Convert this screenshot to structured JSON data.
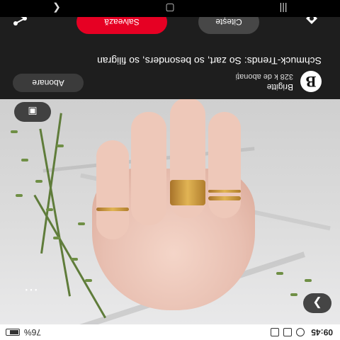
{
  "status_bar": {
    "time": "09:45",
    "battery": "76%"
  },
  "pin": {
    "author": "Brigitte",
    "followers": "328 k de abonați",
    "follow_label": "Abonare",
    "title": "Schmuck-Trends: So zart, so besonders, so filigran",
    "avatar_letter": "B"
  },
  "actions": {
    "read_label": "Citește",
    "save_label": "Salvează",
    "save_color": "#e60023"
  },
  "icons": {
    "share": "share-icon",
    "pinterest_lens": "lens-icon",
    "next": "chevron-right-icon",
    "more": "more-icon"
  }
}
